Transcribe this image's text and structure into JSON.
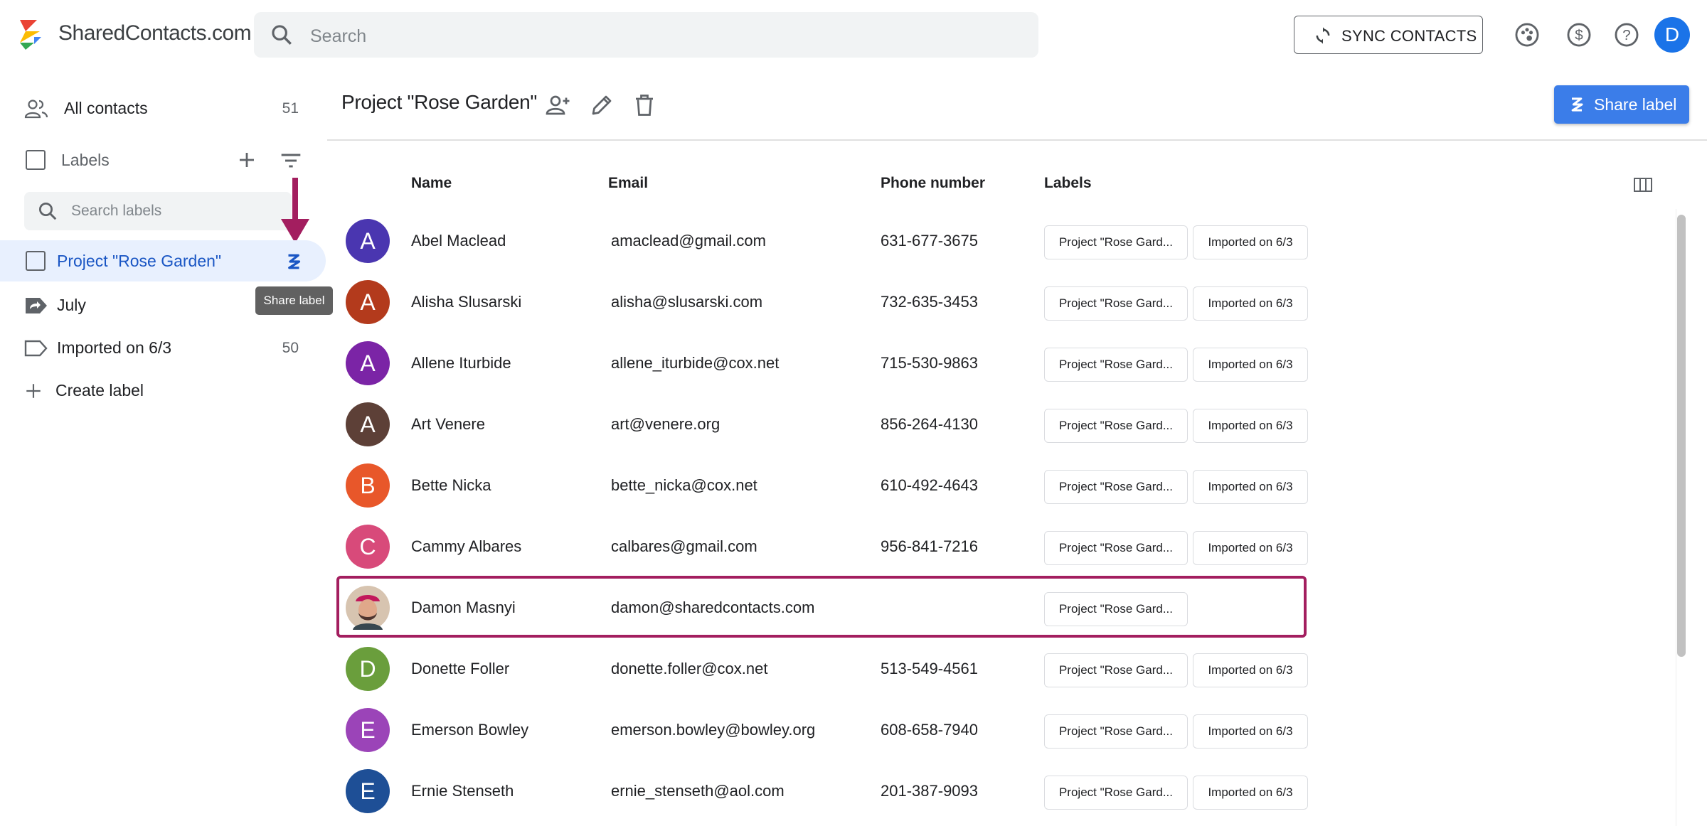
{
  "header": {
    "brand": "SharedContacts.com",
    "search_placeholder": "Search",
    "sync_label": "SYNC CONTACTS",
    "avatar_letter": "D",
    "accent_color": "#1a73e8"
  },
  "sidebar": {
    "all_contacts": {
      "label": "All contacts",
      "count": "51"
    },
    "labels_header": "Labels",
    "search_placeholder": "Search labels",
    "items": [
      {
        "label": "Project \"Rose Garden\"",
        "count": "",
        "icon": "checkbox",
        "active": true
      },
      {
        "label": "July",
        "count": "",
        "icon": "shared-label-icon"
      },
      {
        "label": "Imported on 6/3",
        "count": "50",
        "icon": "label-icon"
      }
    ],
    "create_label": "Create label",
    "tooltip": "Share label"
  },
  "main": {
    "title": "Project \"Rose Garden\"",
    "share_label_button": "Share label",
    "columns": [
      "Name",
      "Email",
      "Phone number",
      "Labels"
    ],
    "contacts": [
      {
        "initial": "A",
        "color": "#4a36b0",
        "name": "Abel Maclead",
        "email": "amaclead@gmail.com",
        "phone": "631-677-3675",
        "labels": [
          "Project \"Rose Gard...",
          "Imported on 6/3"
        ]
      },
      {
        "initial": "A",
        "color": "#b33a1c",
        "name": "Alisha Slusarski",
        "email": "alisha@slusarski.com",
        "phone": "732-635-3453",
        "labels": [
          "Project \"Rose Gard...",
          "Imported on 6/3"
        ]
      },
      {
        "initial": "A",
        "color": "#7b24a6",
        "name": "Allene Iturbide",
        "email": "allene_iturbide@cox.net",
        "phone": "715-530-9863",
        "labels": [
          "Project \"Rose Gard...",
          "Imported on 6/3"
        ]
      },
      {
        "initial": "A",
        "color": "#5d4037",
        "name": "Art Venere",
        "email": "art@venere.org",
        "phone": "856-264-4130",
        "labels": [
          "Project \"Rose Gard...",
          "Imported on 6/3"
        ]
      },
      {
        "initial": "B",
        "color": "#e8572a",
        "name": "Bette Nicka",
        "email": "bette_nicka@cox.net",
        "phone": "610-492-4643",
        "labels": [
          "Project \"Rose Gard...",
          "Imported on 6/3"
        ]
      },
      {
        "initial": "C",
        "color": "#d84a7a",
        "name": "Cammy Albares",
        "email": "calbares@gmail.com",
        "phone": "956-841-7216",
        "labels": [
          "Project \"Rose Gard...",
          "Imported on 6/3"
        ]
      },
      {
        "initial": "",
        "color": "#8d6e63",
        "name": "Damon Masnyi",
        "email": "damon@sharedcontacts.com",
        "phone": "",
        "labels": [
          "Project \"Rose Gard..."
        ],
        "photo": true
      },
      {
        "initial": "D",
        "color": "#6a9e3c",
        "name": "Donette Foller",
        "email": "donette.foller@cox.net",
        "phone": "513-549-4561",
        "labels": [
          "Project \"Rose Gard...",
          "Imported on 6/3"
        ]
      },
      {
        "initial": "E",
        "color": "#9b44b8",
        "name": "Emerson Bowley",
        "email": "emerson.bowley@bowley.org",
        "phone": "608-658-7940",
        "labels": [
          "Project \"Rose Gard...",
          "Imported on 6/3"
        ]
      },
      {
        "initial": "E",
        "color": "#1e4f96",
        "name": "Ernie Stenseth",
        "email": "ernie_stenseth@aol.com",
        "phone": "201-387-9093",
        "labels": [
          "Project \"Rose Gard...",
          "Imported on 6/3"
        ]
      }
    ]
  }
}
